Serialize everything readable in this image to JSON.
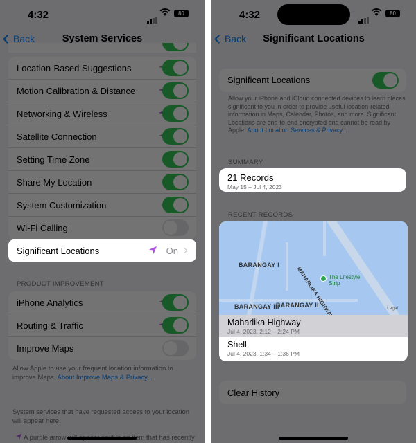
{
  "left": {
    "time": "4:32",
    "battery": "80",
    "nav": {
      "back": "Back",
      "title": "System Services"
    },
    "items": [
      {
        "label": "Location-Based Suggestions",
        "arrow": "gray",
        "toggle": "on"
      },
      {
        "label": "Motion Calibration & Distance",
        "arrow": "purple",
        "toggle": "on"
      },
      {
        "label": "Networking & Wireless",
        "arrow": "purple",
        "toggle": "on"
      },
      {
        "label": "Satellite Connection",
        "arrow": "gray",
        "toggle": "on"
      },
      {
        "label": "Setting Time Zone",
        "arrow": "",
        "toggle": "on"
      },
      {
        "label": "Share My Location",
        "arrow": "",
        "toggle": "on"
      },
      {
        "label": "System Customization",
        "arrow": "",
        "toggle": "on"
      },
      {
        "label": "Wi-Fi Calling",
        "arrow": "",
        "toggle": "off"
      }
    ],
    "significant": {
      "label": "Significant Locations",
      "value": "On"
    },
    "product_header": "PRODUCT IMPROVEMENT",
    "product_items": [
      {
        "label": "iPhone Analytics",
        "arrow": "gray",
        "toggle": "on"
      },
      {
        "label": "Routing & Traffic",
        "arrow": "purple",
        "toggle": "on"
      },
      {
        "label": "Improve Maps",
        "arrow": "",
        "toggle": "off"
      }
    ],
    "footer": {
      "text": "Allow Apple to use your frequent location information to improve Maps.",
      "link": "About Improve Maps & Privacy..."
    },
    "footer2": "System services that have requested access to your location will appear here.",
    "footer3": "A purple arrow will appear next to an item that has recently"
  },
  "right": {
    "time": "4:32",
    "battery": "80",
    "nav": {
      "back": "Back",
      "title": "Significant Locations"
    },
    "toggle_label": "Significant Locations",
    "desc": "Allow your iPhone and iCloud connected devices to learn places significant to you in order to provide useful location-related information in Maps, Calendar, Photos, and more. Significant Locations are end-to-end encrypted and cannot be read by Apple.",
    "desc_link": "About Location Services & Privacy...",
    "summary_header": "SUMMARY",
    "summary": {
      "title": "21 Records",
      "subtitle": "May 15 – Jul 4, 2023"
    },
    "recent_header": "RECENT RECORDS",
    "map_labels": {
      "b1": "BARANGAY I",
      "b2": "BARANGAY II",
      "b3": "BARANGAY III",
      "hwy": "MAHARLIKA HIGHWAY",
      "poi": "The Lifestyle Strip",
      "legal": "Legal"
    },
    "records": [
      {
        "title": "Maharlika Highway",
        "subtitle": "Jul 4, 2023, 2:12 – 2:24 PM"
      },
      {
        "title": "Shell",
        "subtitle": "Jul 4, 2023, 1:34 – 1:36 PM"
      }
    ],
    "clear": "Clear History"
  },
  "colors": {
    "accent": "#0a84ff",
    "green": "#34c759",
    "purple": "#af52de"
  }
}
